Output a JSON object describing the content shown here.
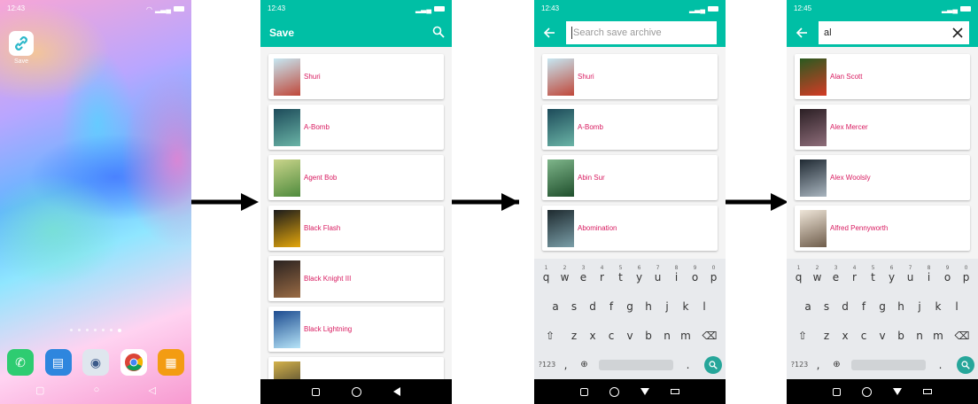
{
  "home": {
    "status_time": "12:43",
    "app_label": "Save"
  },
  "screens": [
    {
      "status_time": "12:43",
      "title": "Save",
      "mode": "list",
      "items": [
        "Shuri",
        "A-Bomb",
        "Agent Bob",
        "Black Flash",
        "Black Knight III",
        "Black Lightning",
        ""
      ]
    },
    {
      "status_time": "12:43",
      "search_placeholder": "Search save archive",
      "search_value": "",
      "mode": "search",
      "items": [
        "Shuri",
        "A-Bomb",
        "Abin Sur",
        "Abomination"
      ]
    },
    {
      "status_time": "12:45",
      "search_placeholder": "",
      "search_value": "al",
      "mode": "search",
      "items": [
        "Alan Scott",
        "Alex Mercer",
        "Alex Woolsly",
        "Alfred Pennyworth"
      ]
    }
  ],
  "keyboard": {
    "row1": [
      "q",
      "w",
      "e",
      "r",
      "t",
      "y",
      "u",
      "i",
      "o",
      "p"
    ],
    "row1_hints": [
      "1",
      "2",
      "3",
      "4",
      "5",
      "6",
      "7",
      "8",
      "9",
      "0"
    ],
    "row2": [
      "a",
      "s",
      "d",
      "f",
      "g",
      "h",
      "j",
      "k",
      "l"
    ],
    "row3": [
      "z",
      "x",
      "c",
      "v",
      "b",
      "n",
      "m"
    ],
    "symbols_key": "?123",
    "comma_key": ",",
    "period_key": "."
  },
  "colors": {
    "primary": "#00bfa5",
    "item_text": "#d81b60",
    "keyboard_enter": "#26a69a"
  },
  "thumb_colors": {
    "Shuri": [
      "#c6e7f2",
      "#c0483a"
    ],
    "A-Bomb": [
      "#1d4b5a",
      "#6ab4a6"
    ],
    "Agent Bob": [
      "#c9d48a",
      "#4f8b3d"
    ],
    "Black Flash": [
      "#1b1b1b",
      "#e4a70c"
    ],
    "Black Knight III": [
      "#2a2220",
      "#9a6b44"
    ],
    "Black Lightning": [
      "#1c4b8f",
      "#b6e4f8"
    ],
    "Abin Sur": [
      "#7eb58a",
      "#1f4f2c"
    ],
    "Abomination": [
      "#1e2a2f",
      "#7a9ea8"
    ],
    "Alan Scott": [
      "#2a5a20",
      "#d43b25"
    ],
    "Alex Mercer": [
      "#2b1f24",
      "#8e6d7a"
    ],
    "Alex Woolsly": [
      "#202a33",
      "#a9b5bf"
    ],
    "Alfred Pennyworth": [
      "#efe6d9",
      "#6e5c4a"
    ]
  }
}
